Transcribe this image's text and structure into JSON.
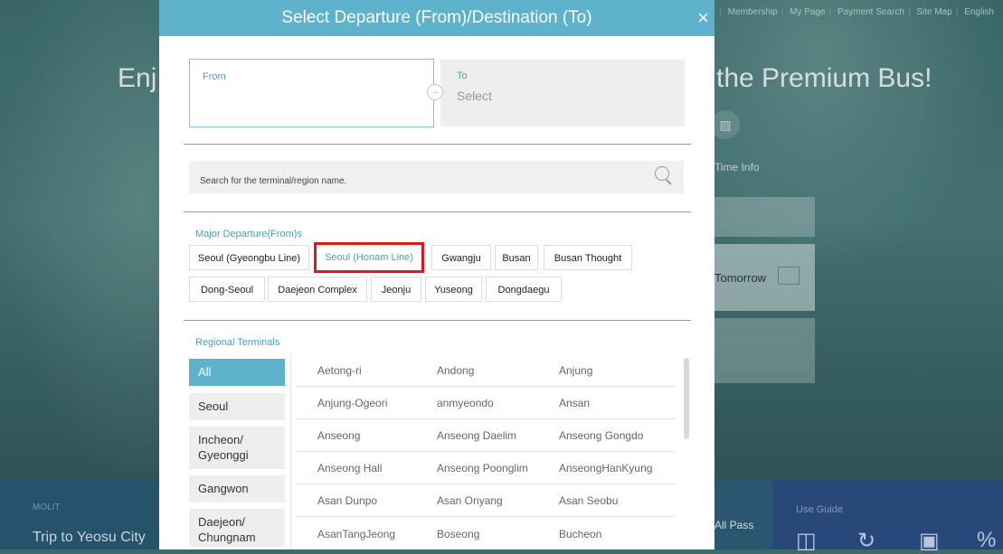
{
  "background": {
    "top_nav": [
      "Membership",
      "My Page",
      "Payment Search",
      "Site Map",
      "English"
    ],
    "hero_left": "Enj",
    "hero_right": "the Premium Bus!",
    "time_info": "Time Info",
    "tomorrow_label": "Tomorrow",
    "molit_label": "MOLIT",
    "trip_text": "Trip to Yeosu City",
    "all_pass": "All Pass",
    "use_guide": "Use Guide"
  },
  "modal": {
    "title": "Select Departure (From)/Destination (To)",
    "close_symbol": "×",
    "from_label": "From",
    "to_label": "To",
    "to_value": "Select",
    "search_placeholder": "Search for the terminal/region name.",
    "major_title": "Major Departure(From)s",
    "major_terminals": [
      "Seoul (Gyeongbu Line)",
      "Seoul (Honam Line)",
      "Gwangju",
      "Busan",
      "Busan Thought",
      "Dong-Seoul",
      "Daejeon Complex",
      "Jeonju",
      "Yuseong",
      "Dongdaegu"
    ],
    "selected_major": "Seoul (Honam Line)",
    "regional_title": "Regional Terminals",
    "regions": [
      "All",
      "Seoul",
      "Incheon/\nGyeonggi",
      "Gangwon",
      "Daejeon/\nChungnam"
    ],
    "active_region": "All",
    "terminals": [
      [
        "Aetong-ri",
        "Andong",
        "Anjung"
      ],
      [
        "Anjung-Ogeori",
        "anmyeondo",
        "Ansan"
      ],
      [
        "Anseong",
        "Anseong Daelim",
        "Anseong Gongdo"
      ],
      [
        "Anseong Hall",
        "Anseong Poonglim",
        "AnseongHanKyung"
      ],
      [
        "Asan Dunpo",
        "Asan Onyang",
        "Asan Seobu"
      ],
      [
        "AsanTangJeong",
        "Boseong",
        "Bucheon"
      ]
    ]
  },
  "colors": {
    "accent": "#5fb2cc",
    "selected_border": "#e0161e",
    "label_blue": "#4aa0bd"
  }
}
